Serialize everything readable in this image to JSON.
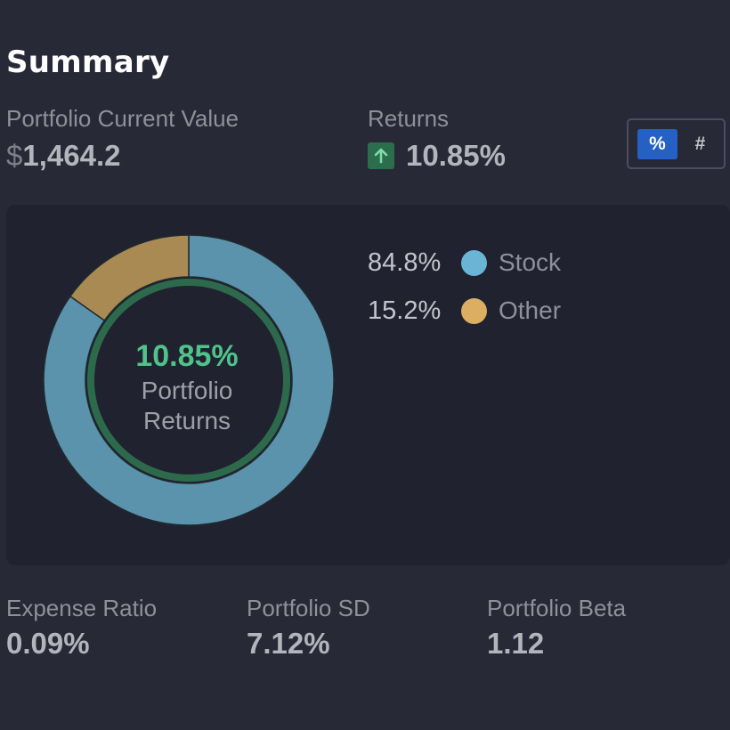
{
  "summary": {
    "title": "Summary",
    "portfolio_value_label": "Portfolio Current Value",
    "portfolio_value_currency": "$",
    "portfolio_value_amount": "1,464.2",
    "returns_label": "Returns",
    "returns_value": "10.85%",
    "returns_direction_icon": "arrow-up-icon",
    "toggle": {
      "percent_label": "%",
      "number_label": "#",
      "selected": "%"
    }
  },
  "chart_data": {
    "type": "pie",
    "style": "donut",
    "center_value": "10.85%",
    "center_label_line1": "Portfolio",
    "center_label_line2": "Returns",
    "slices": [
      {
        "name": "Stock",
        "value": 84.8,
        "label": "84.8%",
        "color": "#5a93ab"
      },
      {
        "name": "Other",
        "value": 15.2,
        "label": "15.2%",
        "color": "#a88a52"
      }
    ],
    "legend_colors": [
      "#6ab5d6",
      "#dcae62"
    ],
    "ring_color": "#2d6a4c",
    "legend_placement": "right"
  },
  "stats": [
    {
      "label": "Expense Ratio",
      "value": "0.09%"
    },
    {
      "label": "Portfolio SD",
      "value": "7.12%"
    },
    {
      "label": "Portfolio Beta",
      "value": "1.12"
    }
  ],
  "colors": {
    "background": "#272a36",
    "panel": "#202230",
    "accent_green": "#4fc38a",
    "accent_blue": "#2561c4"
  }
}
